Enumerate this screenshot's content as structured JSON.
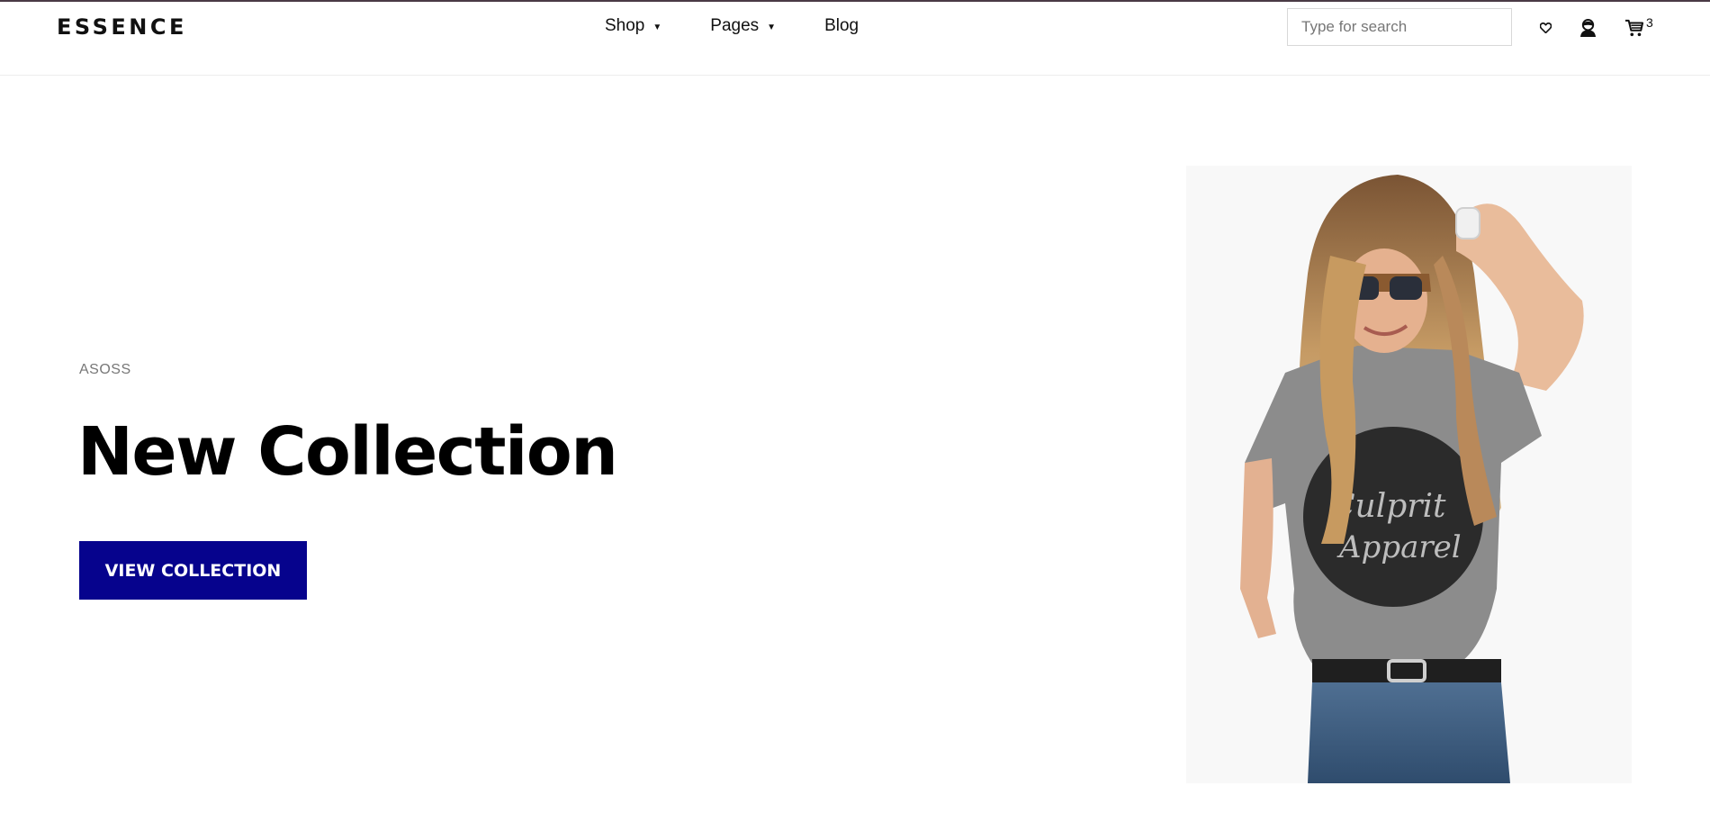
{
  "header": {
    "logo": "ESSENCE",
    "nav": [
      {
        "label": "Shop",
        "has_dropdown": true
      },
      {
        "label": "Pages",
        "has_dropdown": true
      },
      {
        "label": "Blog",
        "has_dropdown": false
      }
    ],
    "search": {
      "placeholder": "Type for search",
      "value": ""
    },
    "icons": [
      "heart-icon",
      "user-icon",
      "cart-icon"
    ],
    "cart_count": "3"
  },
  "hero": {
    "brand": "ASOSS",
    "title": "New Collection",
    "cta_label": "VIEW COLLECTION",
    "cta_color": "#06038d"
  }
}
